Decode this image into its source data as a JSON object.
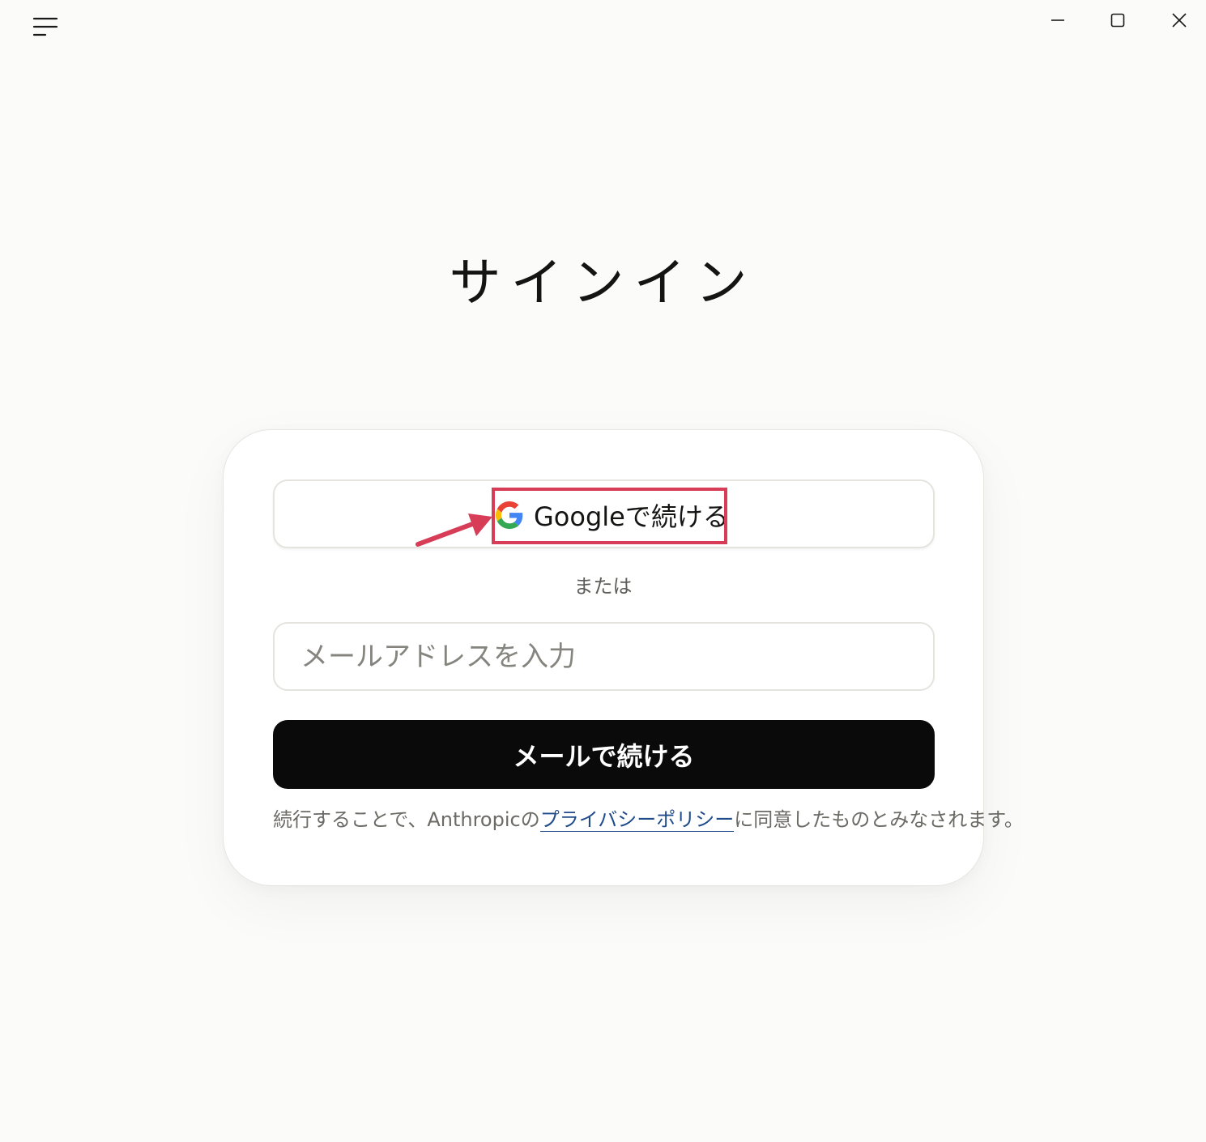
{
  "titlebar": {
    "menu_icon": "hamburger-menu-icon",
    "controls": [
      "minimize-icon",
      "maximize-icon",
      "close-icon"
    ]
  },
  "page": {
    "title": "サインイン"
  },
  "signin": {
    "google_button_label": "Googleで続ける",
    "google_icon": "google-g-icon",
    "separator": "または",
    "email_placeholder": "メールアドレスを入力",
    "email_button_label": "メールで続ける",
    "legal_prefix": "続行することで、Anthropicの",
    "legal_link": "プライバシーポリシー",
    "legal_suffix": "に同意したものとみなされます。"
  },
  "annotation": {
    "highlight_color": "#d83d57",
    "arrow_color": "#d83d57"
  },
  "colors": {
    "background": "#fbfbf9",
    "primary_button": "#0a0a0a",
    "link": "#1f4b8a"
  }
}
